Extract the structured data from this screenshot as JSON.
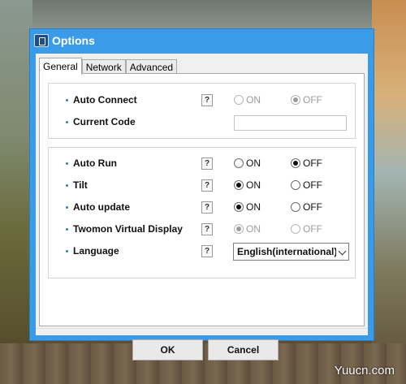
{
  "window": {
    "title": "Options"
  },
  "tabs": [
    {
      "label": "General",
      "active": true
    },
    {
      "label": "Network",
      "active": false
    },
    {
      "label": "Advanced",
      "active": false
    }
  ],
  "help_glyph": "?",
  "group1": {
    "auto_connect": {
      "label": "Auto Connect",
      "on_label": "ON",
      "off_label": "OFF",
      "selected": "OFF",
      "enabled": false
    },
    "current_code": {
      "label": "Current Code",
      "value": ""
    }
  },
  "group2": {
    "auto_run": {
      "label": "Auto Run",
      "on_label": "ON",
      "off_label": "OFF",
      "selected": "OFF",
      "enabled": true
    },
    "tilt": {
      "label": "Tilt",
      "on_label": "ON",
      "off_label": "OFF",
      "selected": "ON",
      "enabled": true
    },
    "auto_update": {
      "label": "Auto update",
      "on_label": "ON",
      "off_label": "OFF",
      "selected": "ON",
      "enabled": true
    },
    "virtual_display": {
      "label": "Twomon Virtual Display",
      "on_label": "ON",
      "off_label": "OFF",
      "selected": "ON",
      "enabled": false
    },
    "language": {
      "label": "Language",
      "selected": "English(international)"
    }
  },
  "buttons": {
    "ok": "OK",
    "cancel": "Cancel"
  },
  "watermark": "Yuucn.com",
  "colors": {
    "titlebar": "#3a9be8",
    "accent_bullet": "#2c7cc0"
  }
}
